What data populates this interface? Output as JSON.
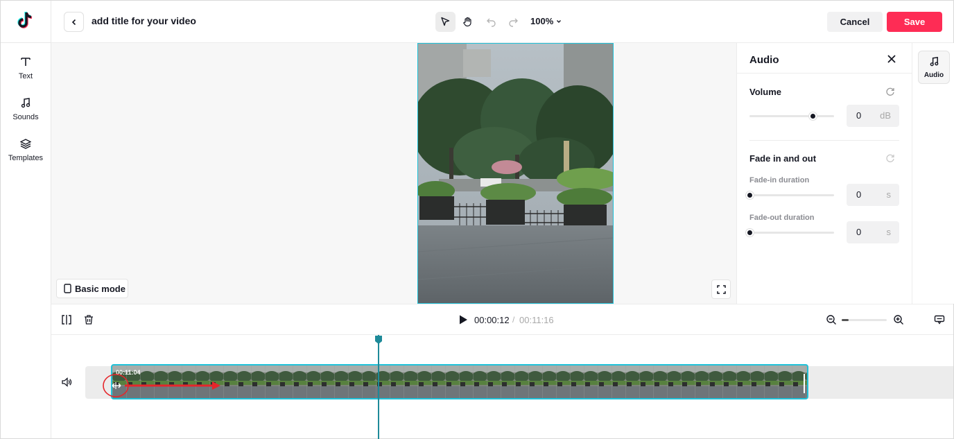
{
  "header": {
    "title": "add title for your video",
    "zoom": "100%",
    "cancel_label": "Cancel",
    "save_label": "Save"
  },
  "rail": {
    "items": [
      {
        "label": "Text",
        "icon": "text-icon"
      },
      {
        "label": "Sounds",
        "icon": "music-note-icon"
      },
      {
        "label": "Templates",
        "icon": "layers-icon"
      }
    ]
  },
  "canvas": {
    "basic_mode_label": "Basic mode"
  },
  "audio_panel": {
    "title": "Audio",
    "volume": {
      "label": "Volume",
      "value": "0",
      "unit": "dB",
      "level": 0.75
    },
    "fade": {
      "label": "Fade in and out",
      "fade_in": {
        "label": "Fade-in duration",
        "value": "0",
        "unit": "s",
        "level": 0
      },
      "fade_out": {
        "label": "Fade-out duration",
        "value": "0",
        "unit": "s",
        "level": 0
      }
    }
  },
  "right_rail": {
    "audio_tab_label": "Audio"
  },
  "timeline": {
    "current_time": "00:00:12",
    "separator": "/",
    "total_time": "00:11:16",
    "clip_time": "00:11:04",
    "zoom_level": 0.15
  },
  "colors": {
    "accent": "#fe2c55",
    "selection": "#20c2d9",
    "playhead": "#1e8a99",
    "annotation": "#e5262b"
  }
}
